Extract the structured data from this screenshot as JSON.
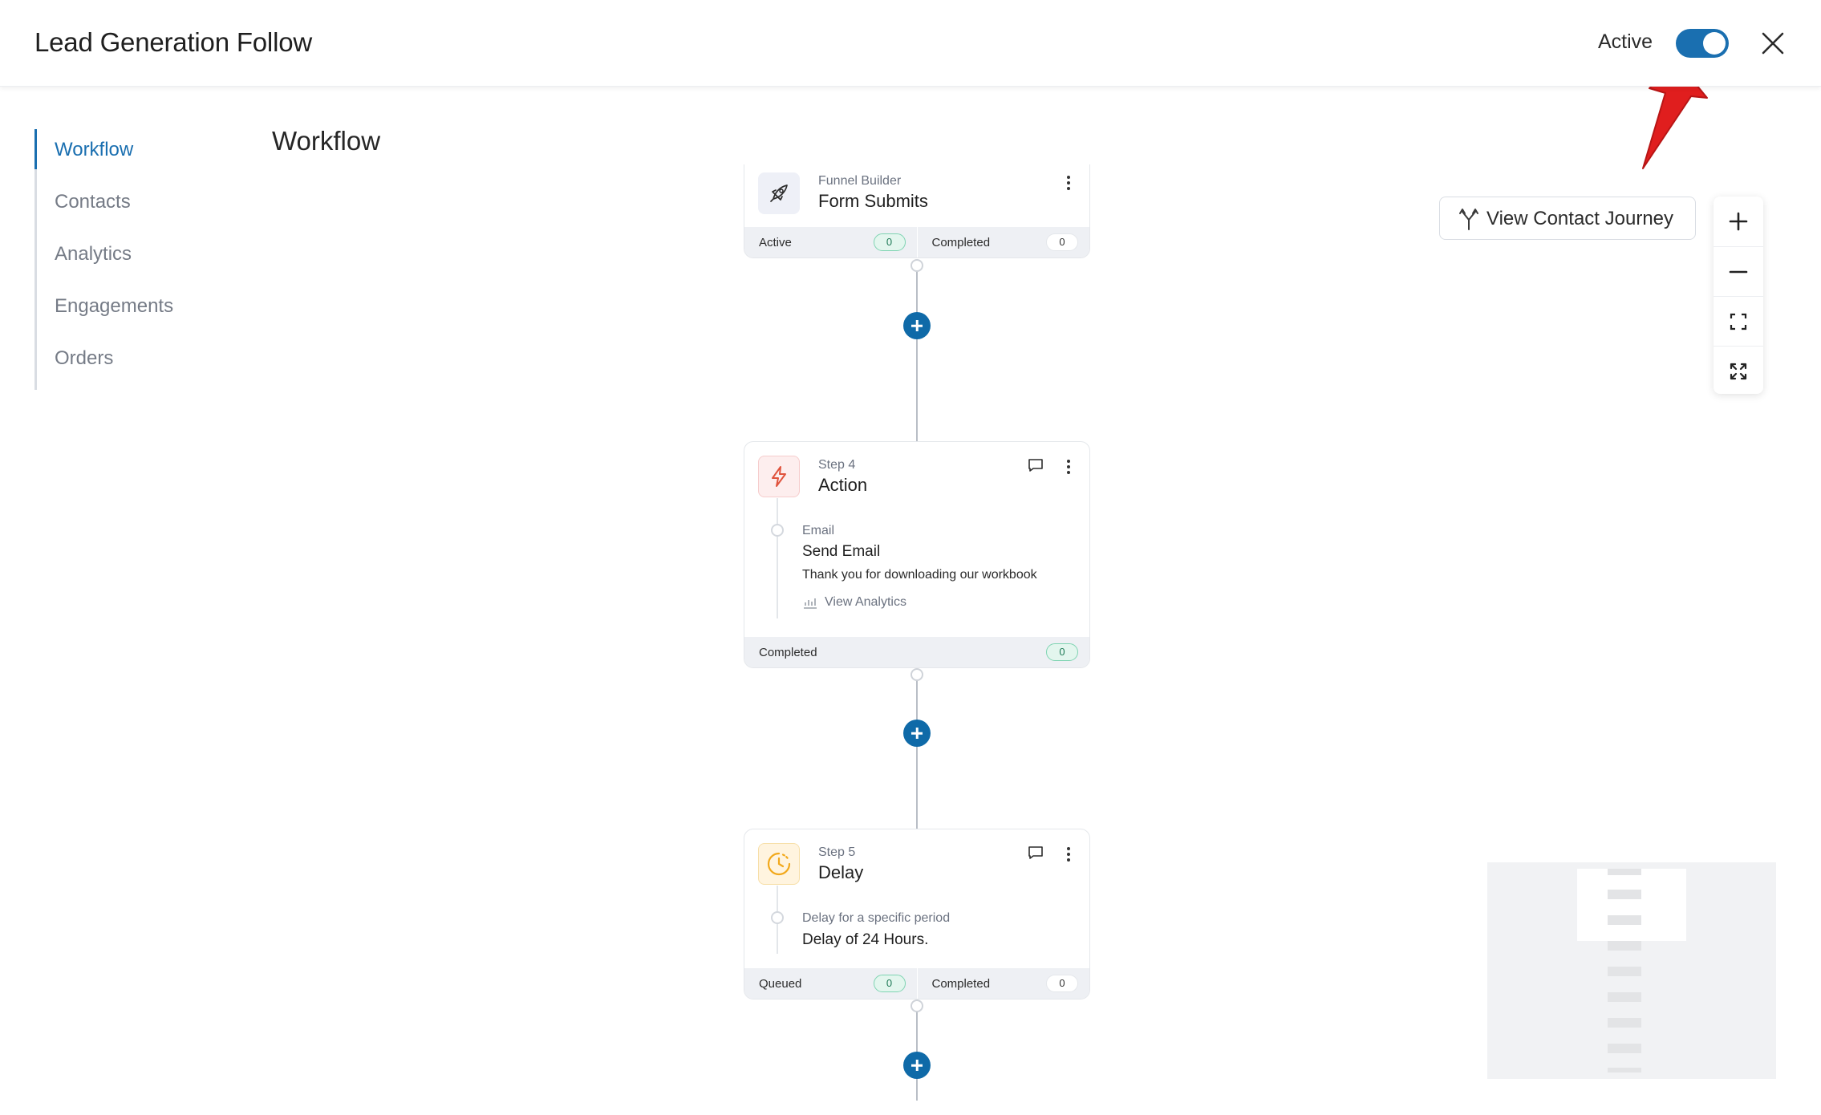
{
  "header": {
    "title": "Lead Generation Follow",
    "active_label": "Active",
    "toggle_state": "on"
  },
  "sidebar": {
    "items": [
      {
        "label": "Workflow",
        "active": true
      },
      {
        "label": "Contacts",
        "active": false
      },
      {
        "label": "Analytics",
        "active": false
      },
      {
        "label": "Engagements",
        "active": false
      },
      {
        "label": "Orders",
        "active": false
      }
    ]
  },
  "main": {
    "title": "Workflow"
  },
  "toolbar": {
    "journey_label": "View Contact Journey"
  },
  "trigger": {
    "subtitle": "Funnel Builder",
    "title": "Form Submits",
    "footer": [
      {
        "label": "Active",
        "count": "0"
      },
      {
        "label": "Completed",
        "count": "0"
      }
    ]
  },
  "step4": {
    "subtitle": "Step 4",
    "title": "Action",
    "detail_type": "Email",
    "detail_title": "Send Email",
    "detail_text": "Thank you for downloading our workbook",
    "analytics_label": "View Analytics",
    "footer": [
      {
        "label": "Completed",
        "count": "0"
      }
    ]
  },
  "step5": {
    "subtitle": "Step 5",
    "title": "Delay",
    "detail_type": "Delay for a specific period",
    "detail_title": "Delay of 24 Hours.",
    "footer": [
      {
        "label": "Queued",
        "count": "0"
      },
      {
        "label": "Completed",
        "count": "0"
      }
    ]
  },
  "colors": {
    "accent": "#1a6fb0",
    "plus_button": "#0f6aa8",
    "annotation_arrow": "#e01e1e"
  },
  "icons": [
    "close-icon",
    "rocket-icon",
    "lightning-icon",
    "clock-icon",
    "comment-icon",
    "kebab-icon",
    "branch-icon",
    "zoom-in-icon",
    "zoom-out-icon",
    "fit-icon",
    "expand-icon",
    "analytics-icon"
  ]
}
